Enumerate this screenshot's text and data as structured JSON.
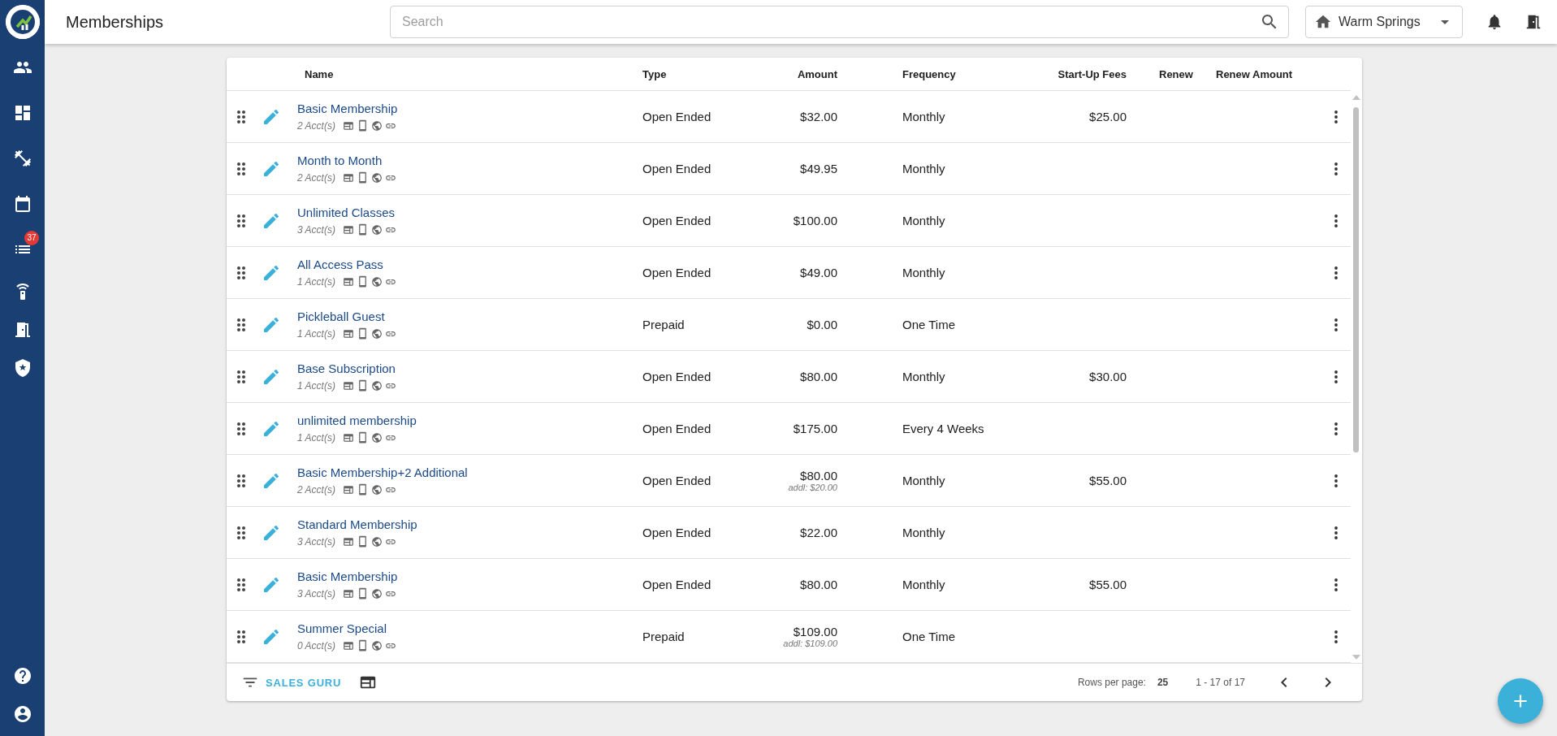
{
  "header": {
    "title": "Memberships",
    "search": {
      "placeholder": "Search"
    },
    "location": "Warm Springs"
  },
  "sidebar": {
    "badge": "37"
  },
  "table": {
    "columns": [
      "Name",
      "Type",
      "Amount",
      "Frequency",
      "Start-Up Fees",
      "Renew",
      "Renew Amount"
    ],
    "rows": [
      {
        "name": "Basic Membership",
        "accounts": "2 Acct(s)",
        "type": "Open Ended",
        "amount": "$32.00",
        "frequency": "Monthly",
        "startup_fees": "$25.00"
      },
      {
        "name": "Month to Month",
        "accounts": "2 Acct(s)",
        "type": "Open Ended",
        "amount": "$49.95",
        "frequency": "Monthly"
      },
      {
        "name": "Unlimited Classes",
        "accounts": "3 Acct(s)",
        "type": "Open Ended",
        "amount": "$100.00",
        "frequency": "Monthly"
      },
      {
        "name": "All Access Pass",
        "accounts": "1 Acct(s)",
        "type": "Open Ended",
        "amount": "$49.00",
        "frequency": "Monthly"
      },
      {
        "name": "Pickleball Guest",
        "accounts": "1 Acct(s)",
        "type": "Prepaid",
        "amount": "$0.00",
        "frequency": "One Time"
      },
      {
        "name": "Base Subscription",
        "accounts": "1 Acct(s)",
        "type": "Open Ended",
        "amount": "$80.00",
        "frequency": "Monthly",
        "startup_fees": "$30.00"
      },
      {
        "name": "unlimited membership",
        "accounts": "1 Acct(s)",
        "type": "Open Ended",
        "amount": "$175.00",
        "frequency": "Every 4 Weeks"
      },
      {
        "name": "Basic Membership+2 Additional",
        "accounts": "2 Acct(s)",
        "type": "Open Ended",
        "amount": "$80.00",
        "additional": "addl: $20.00",
        "frequency": "Monthly",
        "startup_fees": "$55.00"
      },
      {
        "name": "Standard Membership",
        "accounts": "3 Acct(s)",
        "type": "Open Ended",
        "amount": "$22.00",
        "frequency": "Monthly"
      },
      {
        "name": "Basic Membership",
        "accounts": "3 Acct(s)",
        "type": "Open Ended",
        "amount": "$80.00",
        "frequency": "Monthly",
        "startup_fees": "$55.00"
      },
      {
        "name": "Summer Special",
        "accounts": "0 Acct(s)",
        "type": "Prepaid",
        "amount": "$109.00",
        "additional": "addl: $109.00",
        "frequency": "One Time"
      }
    ]
  },
  "footer": {
    "filter_button": "SALES GURU",
    "rows_per_page_label": "Rows per page:",
    "rows_per_page": "25",
    "range": "1 - 17 of 17"
  }
}
